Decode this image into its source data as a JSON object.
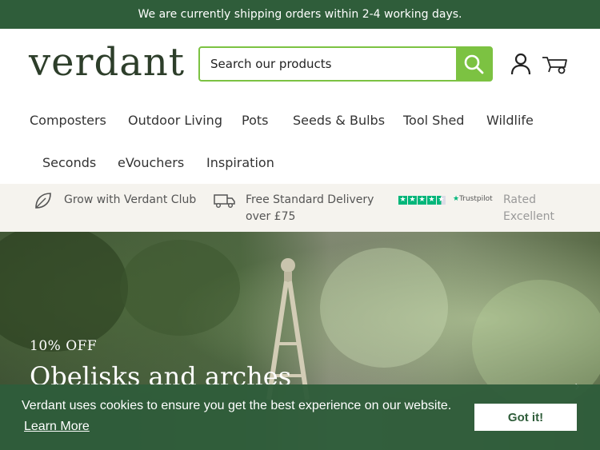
{
  "announcement": {
    "text": "We are currently shipping orders within 2-4 working days."
  },
  "header": {
    "logo": "verdant",
    "search": {
      "placeholder": "Search our products",
      "value": ""
    },
    "icons": {
      "search": "search-icon",
      "account": "user-icon",
      "cart": "wheelbarrow-cart-icon"
    }
  },
  "nav": {
    "items": [
      {
        "label": "Composters"
      },
      {
        "label": "Outdoor Living"
      },
      {
        "label": "Pots"
      },
      {
        "label": "Seeds & Bulbs"
      },
      {
        "label": "Tool Shed"
      },
      {
        "label": "Wildlife"
      },
      {
        "label": "Seconds"
      },
      {
        "label": "eVouchers"
      },
      {
        "label": "Inspiration"
      }
    ]
  },
  "usp": {
    "club": {
      "icon": "leaf-icon",
      "label": "Grow with Verdant Club"
    },
    "delivery": {
      "icon": "delivery-truck-icon",
      "line1": "Free Standard Delivery",
      "line2": "over £75"
    },
    "trustpilot": {
      "logo": "Trustpilot",
      "line1": "Rated",
      "line2": "Excellent",
      "stars": 4.5,
      "color": "#00b67a"
    }
  },
  "hero": {
    "offer": "10% OFF",
    "title": "Obelisks and arches",
    "next_icon": "chevron-right-icon"
  },
  "cookie": {
    "message": "Verdant uses cookies to ensure you get the best experience on our website.",
    "link": "Learn More",
    "button": "Got it!"
  },
  "colors": {
    "brand_green": "#2f5d3a",
    "accent_green": "#7cc242",
    "usp_bg": "#f5f3ee"
  }
}
